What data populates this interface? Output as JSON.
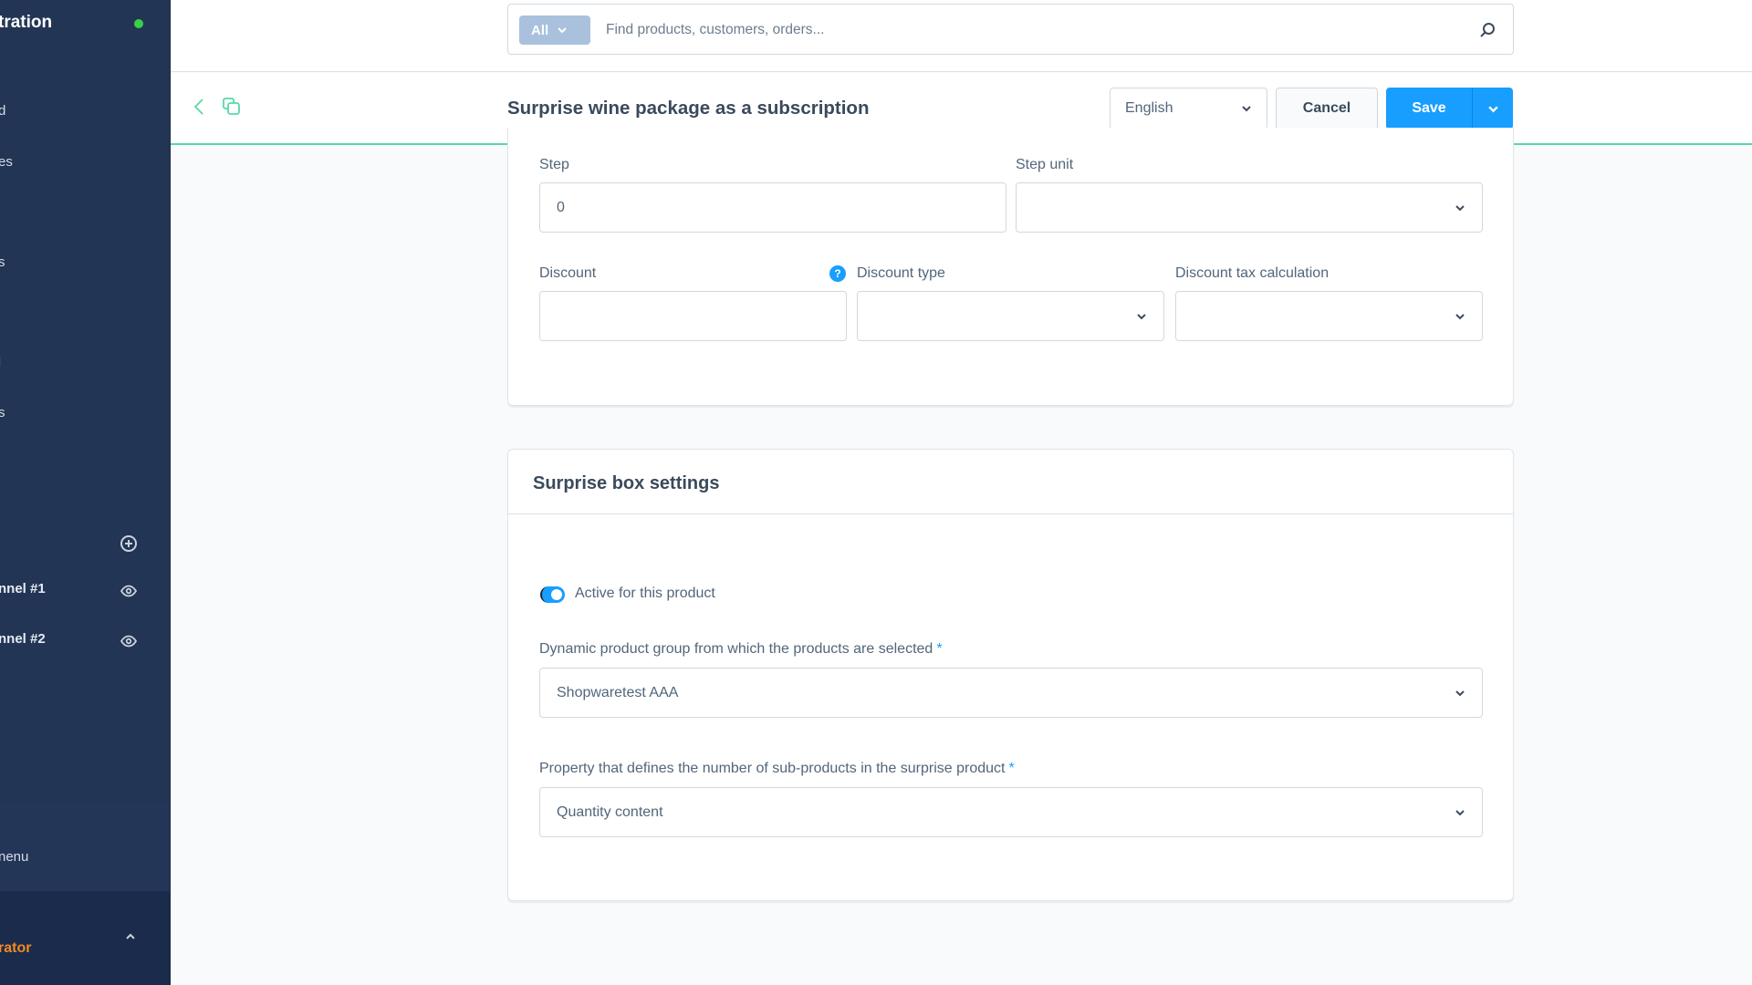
{
  "sidebar": {
    "title": "tration",
    "status_color": "#37d046",
    "items": [
      {
        "label": "d"
      },
      {
        "label": "es"
      },
      {
        "label": "s"
      },
      {
        "label": "l"
      },
      {
        "label": "s"
      }
    ],
    "add_icon": "plus-circle-icon",
    "channels": [
      {
        "label": "nnel #1",
        "icon": "eye-icon"
      },
      {
        "label": "nnel #2",
        "icon": "eye-icon"
      }
    ],
    "menu_label": "nenu",
    "user_role": "rator"
  },
  "search": {
    "type_label": "All",
    "placeholder": "Find products, customers, orders..."
  },
  "header": {
    "title": "Surprise wine package as a subscription",
    "language": "English",
    "cancel_label": "Cancel",
    "save_label": "Save"
  },
  "card_pricing": {
    "step": {
      "label": "Step",
      "value": "0"
    },
    "step_unit": {
      "label": "Step unit",
      "value": ""
    },
    "discount": {
      "label": "Discount",
      "value": ""
    },
    "discount_type": {
      "label": "Discount type",
      "value": ""
    },
    "discount_tax": {
      "label": "Discount tax calculation",
      "value": ""
    },
    "help_glyph": "?"
  },
  "card_surprise": {
    "title": "Surprise box settings",
    "active_label": "Active for this product",
    "active": true,
    "product_group": {
      "label": "Dynamic product group from which the products are selected",
      "required_marker": "*",
      "value": "Shopwaretest AAA"
    },
    "property": {
      "label": "Property that defines the number of sub-products in the surprise product",
      "required_marker": "*",
      "value": "Quantity content"
    }
  },
  "colors": {
    "sidebar_bg": "#233554",
    "accent": "#189eff",
    "header_accent": "#57d9a3",
    "user_role": "#f08a24"
  }
}
